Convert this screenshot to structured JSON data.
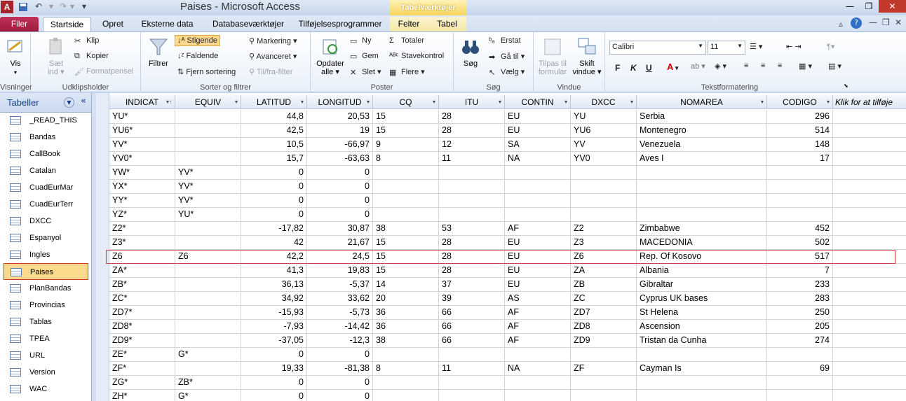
{
  "window": {
    "title": "Paises - Microsoft Access",
    "context_tab_title": "Tabelværktøjer",
    "app_icon": "A"
  },
  "tabs": [
    "Filer",
    "Startside",
    "Opret",
    "Eksterne data",
    "Databaseværktøjer",
    "Tilføjelsesprogrammer",
    "Felter",
    "Tabel"
  ],
  "ribbon": {
    "views": {
      "button": "Vis",
      "group": "Visninger"
    },
    "clipboard": {
      "paste": "Sæt ind",
      "cut": "Klip",
      "copy": "Kopier",
      "format_painter": "Formatpensel",
      "group": "Udklipsholder"
    },
    "sort": {
      "filter": "Filtrer",
      "ascending": "Stigende",
      "descending": "Faldende",
      "remove_sort": "Fjern sortering",
      "selection": "Markering",
      "advanced": "Avanceret",
      "toggle_filter": "Til/fra-filter",
      "group": "Sorter og filtrer"
    },
    "records": {
      "refresh": "Opdater alle",
      "new": "Ny",
      "save": "Gem",
      "delete": "Slet",
      "totals": "Totaler",
      "spelling": "Stavekontrol",
      "more": "Flere",
      "group": "Poster"
    },
    "find": {
      "find": "Søg",
      "replace": "Erstat",
      "goto": "Gå til",
      "select": "Vælg",
      "group": "Søg"
    },
    "window": {
      "fit": "Tilpas til formular",
      "switch": "Skift vindue",
      "group": "Vindue"
    },
    "text": {
      "font": "Calibri",
      "size": "11",
      "bold": "F",
      "italic": "K",
      "underline": "U",
      "group": "Tekstformatering"
    },
    "colors": {
      "accent": "#a4262c",
      "highlight_nav": "#fcd98c",
      "highlight_border": "#d0424f"
    }
  },
  "nav": {
    "title": "Tabeller",
    "items": [
      "_READ_THIS",
      "Bandas",
      "CallBook",
      "Catalan",
      "CuadEurMar",
      "CuadEurTerr",
      "DXCC",
      "Espanyol",
      "Ingles",
      "Paises",
      "PlanBandas",
      "Provincias",
      "Tablas",
      "TPEA",
      "URL",
      "Version",
      "WAC"
    ],
    "selected": "Paises"
  },
  "table": {
    "columns": [
      "INDICAT",
      "EQUIV",
      "LATITUD",
      "LONGITUD",
      "CQ",
      "ITU",
      "CONTIN",
      "DXCC",
      "NOMAREA",
      "CODIGO",
      "Klik for at tilføje"
    ],
    "rows": [
      [
        "YU*",
        "",
        "44,8",
        "20,53",
        "15",
        "28",
        "EU",
        "YU",
        "Serbia",
        "296"
      ],
      [
        "YU6*",
        "",
        "42,5",
        "19",
        "15",
        "28",
        "EU",
        "YU6",
        "Montenegro",
        "514"
      ],
      [
        "YV*",
        "",
        "10,5",
        "-66,97",
        "9",
        "12",
        "SA",
        "YV",
        "Venezuela",
        "148"
      ],
      [
        "YV0*",
        "",
        "15,7",
        "-63,63",
        "8",
        "11",
        "NA",
        "YV0",
        "Aves I",
        "17"
      ],
      [
        "YW*",
        "YV*",
        "0",
        "0",
        "",
        "",
        "",
        "",
        "",
        ""
      ],
      [
        "YX*",
        "YV*",
        "0",
        "0",
        "",
        "",
        "",
        "",
        "",
        ""
      ],
      [
        "YY*",
        "YV*",
        "0",
        "0",
        "",
        "",
        "",
        "",
        "",
        ""
      ],
      [
        "YZ*",
        "YU*",
        "0",
        "0",
        "",
        "",
        "",
        "",
        "",
        ""
      ],
      [
        "Z2*",
        "",
        "-17,82",
        "30,87",
        "38",
        "53",
        "AF",
        "Z2",
        "Zimbabwe",
        "452"
      ],
      [
        "Z3*",
        "",
        "42",
        "21,67",
        "15",
        "28",
        "EU",
        "Z3",
        "MACEDONIA",
        "502"
      ],
      [
        "Z6",
        "Z6",
        "42,2",
        "24,5",
        "15",
        "28",
        "EU",
        "Z6",
        "Rep. Of Kosovo",
        "517"
      ],
      [
        "ZA*",
        "",
        "41,3",
        "19,83",
        "15",
        "28",
        "EU",
        "ZA",
        "Albania",
        "7"
      ],
      [
        "ZB*",
        "",
        "36,13",
        "-5,37",
        "14",
        "37",
        "EU",
        "ZB",
        "Gibraltar",
        "233"
      ],
      [
        "ZC*",
        "",
        "34,92",
        "33,62",
        "20",
        "39",
        "AS",
        "ZC",
        "Cyprus UK bases",
        "283"
      ],
      [
        "ZD7*",
        "",
        "-15,93",
        "-5,73",
        "36",
        "66",
        "AF",
        "ZD7",
        "St Helena",
        "250"
      ],
      [
        "ZD8*",
        "",
        "-7,93",
        "-14,42",
        "36",
        "66",
        "AF",
        "ZD8",
        "Ascension",
        "205"
      ],
      [
        "ZD9*",
        "",
        "-37,05",
        "-12,3",
        "38",
        "66",
        "AF",
        "ZD9",
        "Tristan da Cunha",
        "274"
      ],
      [
        "ZE*",
        "G*",
        "0",
        "0",
        "",
        "",
        "",
        "",
        "",
        ""
      ],
      [
        "ZF*",
        "",
        "19,33",
        "-81,38",
        "8",
        "11",
        "NA",
        "ZF",
        "Cayman Is",
        "69"
      ],
      [
        "ZG*",
        "ZB*",
        "0",
        "0",
        "",
        "",
        "",
        "",
        "",
        ""
      ],
      [
        "ZH*",
        "G*",
        "0",
        "0",
        "",
        "",
        "",
        "",
        "",
        ""
      ]
    ]
  }
}
